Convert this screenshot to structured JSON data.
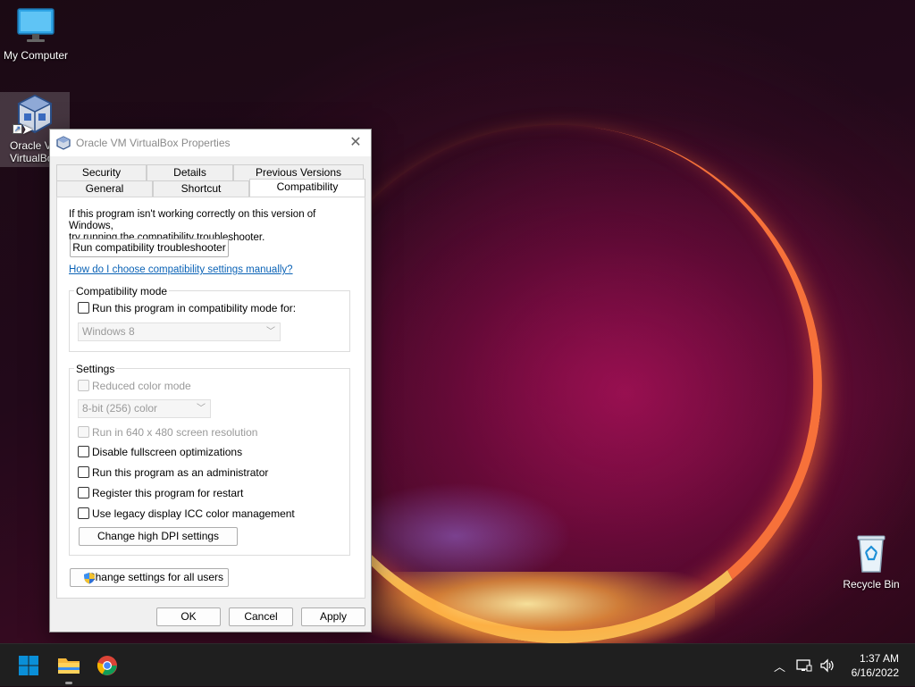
{
  "desktop": {
    "icons": [
      {
        "label": "My Computer"
      },
      {
        "label_line1": "Oracle V",
        "label_line2": "VirtualBo"
      },
      {
        "label": "Recycle Bin"
      }
    ]
  },
  "dialog": {
    "title": "Oracle VM VirtualBox Properties",
    "tabs_row1": [
      "Security",
      "Details",
      "Previous Versions"
    ],
    "tabs_row2": [
      "General",
      "Shortcut",
      "Compatibility"
    ],
    "intro_line1": "If this program isn't working correctly on this version of Windows,",
    "intro_line2": "try running the compatibility troubleshooter.",
    "troubleshooter_button": "Run compatibility troubleshooter",
    "help_link": "How do I choose compatibility settings manually?",
    "compat_mode": {
      "group_title": "Compatibility mode",
      "checkbox_label": "Run this program in compatibility mode for:",
      "os_selected": "Windows 8"
    },
    "settings": {
      "group_title": "Settings",
      "reduced_color": "Reduced color mode",
      "color_selected": "8-bit (256) color",
      "run_640": "Run in 640 x 480 screen resolution",
      "disable_fullscreen": "Disable fullscreen optimizations",
      "run_admin": "Run this program as an administrator",
      "register_restart": "Register this program for restart",
      "legacy_icc": "Use legacy display ICC color management",
      "dpi_button": "Change high DPI settings"
    },
    "all_users_button": "Change settings for all users",
    "ok": "OK",
    "cancel": "Cancel",
    "apply": "Apply"
  },
  "taskbar": {
    "time": "1:37 AM",
    "date": "6/16/2022"
  },
  "colors": {
    "link": "#0b63b6",
    "windows_blue": "#0a8fd8",
    "taskbar_bg": "#1f1f1f"
  }
}
